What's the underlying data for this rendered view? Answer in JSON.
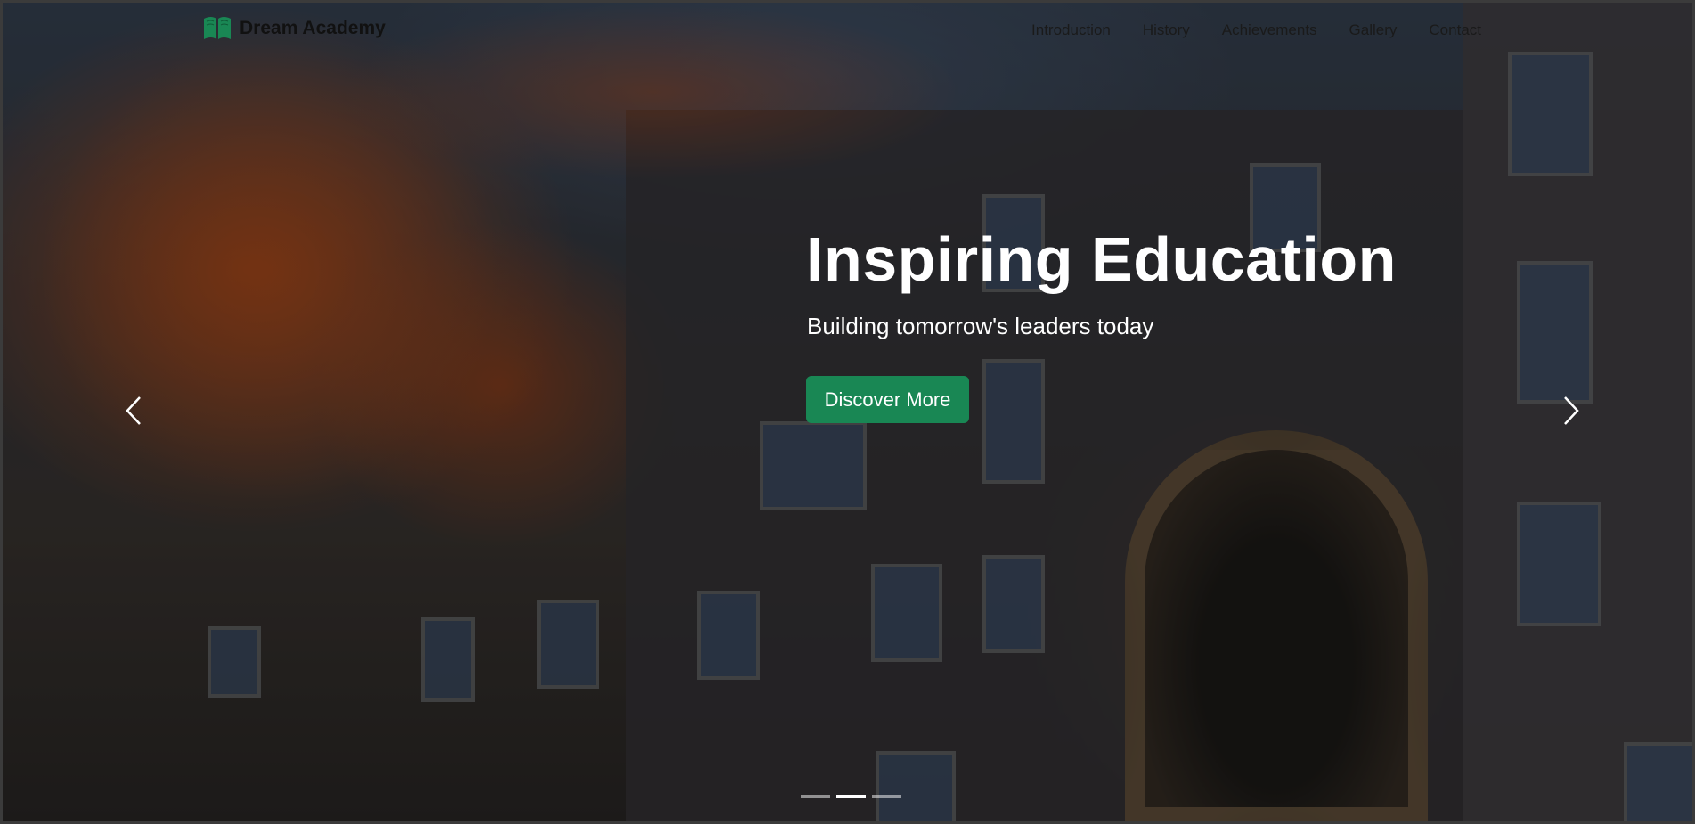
{
  "brand": {
    "name": "Dream Academy",
    "icon": "book-icon",
    "color": "#198754"
  },
  "nav": {
    "links": [
      {
        "label": "Introduction"
      },
      {
        "label": "History"
      },
      {
        "label": "Achievements"
      },
      {
        "label": "Gallery"
      },
      {
        "label": "Contact"
      }
    ]
  },
  "hero": {
    "title": "Inspiring Education",
    "subtitle": "Building tomorrow's leaders today",
    "cta_label": "Discover More",
    "cta_color": "#198754"
  },
  "carousel": {
    "prev_icon": "chevron-left-icon",
    "next_icon": "chevron-right-icon",
    "slide_count": 3,
    "active_index": 1
  }
}
